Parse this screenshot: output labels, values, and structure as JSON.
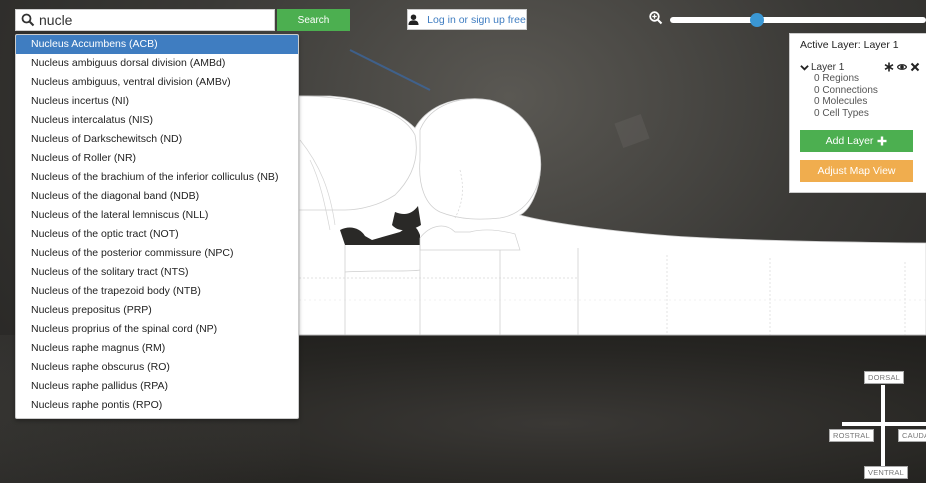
{
  "search": {
    "value": "nucle",
    "button_label": "Search"
  },
  "dropdown": {
    "items": [
      "Nucleus Accumbens (ACB)",
      "Nucleus ambiguus dorsal division (AMBd)",
      "Nucleus ambiguus, ventral division (AMBv)",
      "Nucleus incertus (NI)",
      "Nucleus intercalatus (NIS)",
      "Nucleus of Darkschewitsch (ND)",
      "Nucleus of Roller (NR)",
      "Nucleus of the brachium of the inferior colliculus (NB)",
      "Nucleus of the diagonal band (NDB)",
      "Nucleus of the lateral lemniscus (NLL)",
      "Nucleus of the optic tract (NOT)",
      "Nucleus of the posterior commissure (NPC)",
      "Nucleus of the solitary tract (NTS)",
      "Nucleus of the trapezoid body (NTB)",
      "Nucleus prepositus (PRP)",
      "Nucleus proprius of the spinal cord (NP)",
      "Nucleus raphe magnus (RM)",
      "Nucleus raphe obscurus (RO)",
      "Nucleus raphe pallidus (RPA)",
      "Nucleus raphe pontis (RPO)"
    ],
    "active_index": 0
  },
  "header": {
    "login_label": "Log in or sign up free"
  },
  "zoom": {
    "level_fraction": 0.34
  },
  "layer_panel": {
    "title": "Active Layer: Layer 1",
    "layer_name": "Layer 1",
    "stats": [
      "0 Regions",
      "0 Connections",
      "0 Molecules",
      "0 Cell Types"
    ],
    "add_layer_label": "Add Layer",
    "adjust_map_label": "Adjust Map View"
  },
  "compass": {
    "dorsal": "DORSAL",
    "rostral": "ROSTRAL",
    "caudal": "CAUDAL",
    "ventral": "VENTRAL"
  },
  "colors": {
    "search_button": "#4caf50",
    "dropdown_active": "#3f7dc1",
    "add_layer": "#4caf50",
    "adjust_map": "#f0ad4e",
    "zoom_handle": "#3a97d4"
  }
}
